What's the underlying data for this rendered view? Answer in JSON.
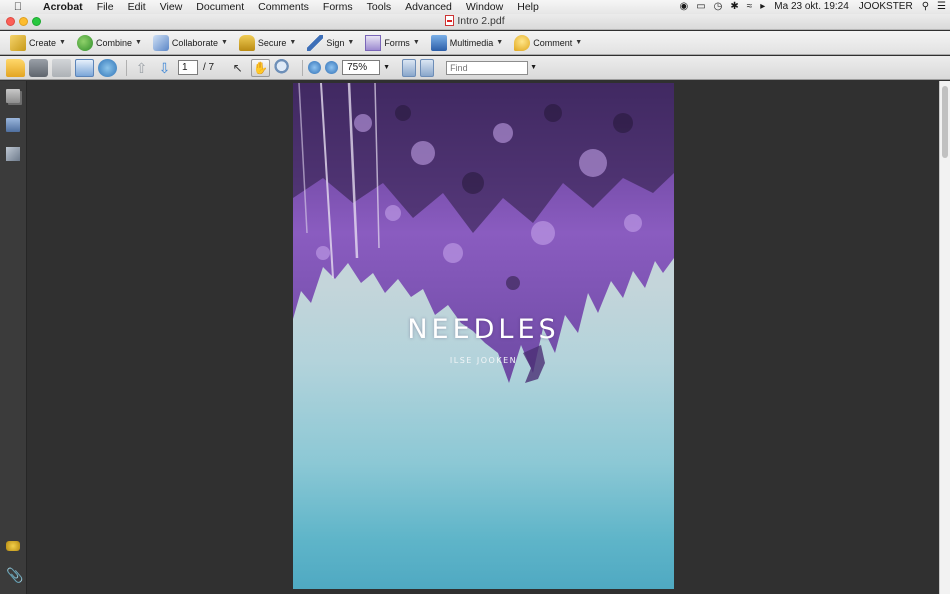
{
  "menubar": {
    "app": "Acrobat",
    "items": [
      "File",
      "Edit",
      "View",
      "Document",
      "Comments",
      "Forms",
      "Tools",
      "Advanced",
      "Window",
      "Help"
    ],
    "status": {
      "datetime": "Ma 23 okt.  19:24",
      "user": "JOOKSTER"
    }
  },
  "window": {
    "title": "Intro 2.pdf"
  },
  "tasks": {
    "create": "Create",
    "combine": "Combine",
    "collaborate": "Collaborate",
    "secure": "Secure",
    "sign": "Sign",
    "forms": "Forms",
    "multimedia": "Multimedia",
    "comment": "Comment"
  },
  "navigation": {
    "page_current": "1",
    "page_total": "/ 7",
    "zoom": "75%",
    "find_placeholder": "Find"
  },
  "document": {
    "cover_title": "NEEDLES",
    "cover_author": "ILSE JOOKEN"
  },
  "colors": {
    "cover_foliage": "#7a4fb0",
    "cover_sky": "#c6d6db",
    "cover_water": "#4fa9c2"
  }
}
